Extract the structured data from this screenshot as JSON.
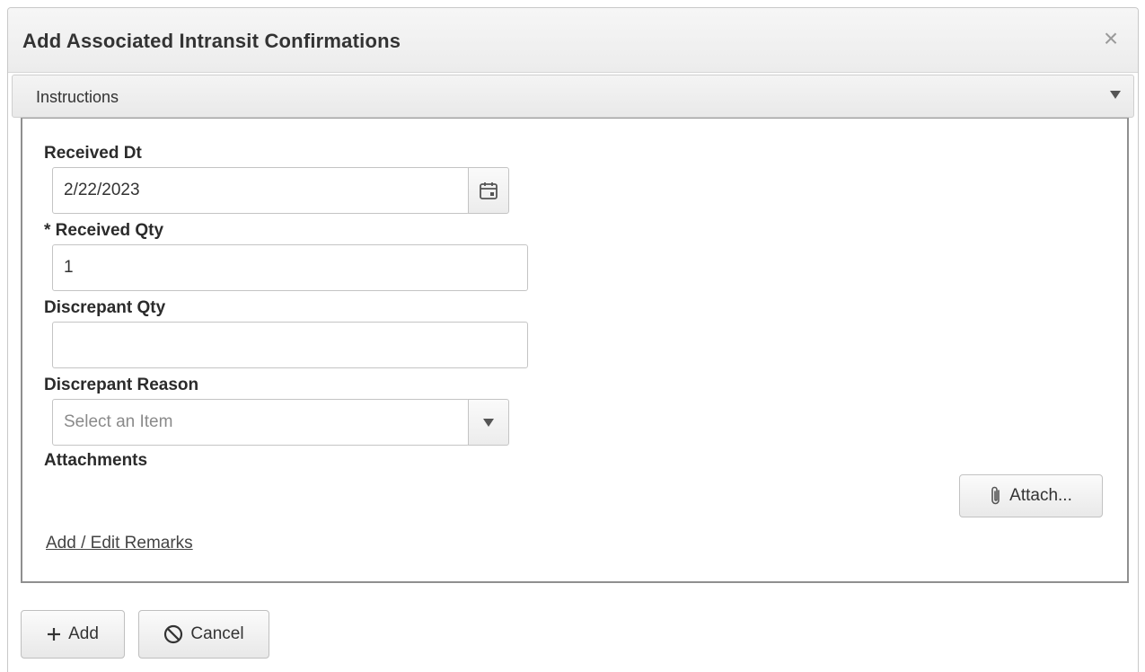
{
  "dialog": {
    "title": "Add Associated Intransit Confirmations",
    "close_label": "×"
  },
  "instructions": {
    "label": "Instructions"
  },
  "form": {
    "received_dt": {
      "label": "Received Dt",
      "value": "2/22/2023"
    },
    "received_qty": {
      "label": "* Received Qty",
      "value": "1"
    },
    "discrepant_qty": {
      "label": "Discrepant Qty",
      "value": ""
    },
    "discrepant_reason": {
      "label": "Discrepant Reason",
      "placeholder": "Select an Item"
    },
    "attachments": {
      "label": "Attachments",
      "button_label": "Attach..."
    },
    "remarks_link": "Add / Edit Remarks"
  },
  "footer": {
    "add_label": "Add",
    "cancel_label": "Cancel"
  },
  "icons": {
    "close": "close-icon",
    "caret": "chevron-down-icon",
    "calendar": "calendar-icon",
    "paperclip": "paperclip-icon",
    "plus": "plus-icon",
    "cancel": "ban-icon"
  }
}
